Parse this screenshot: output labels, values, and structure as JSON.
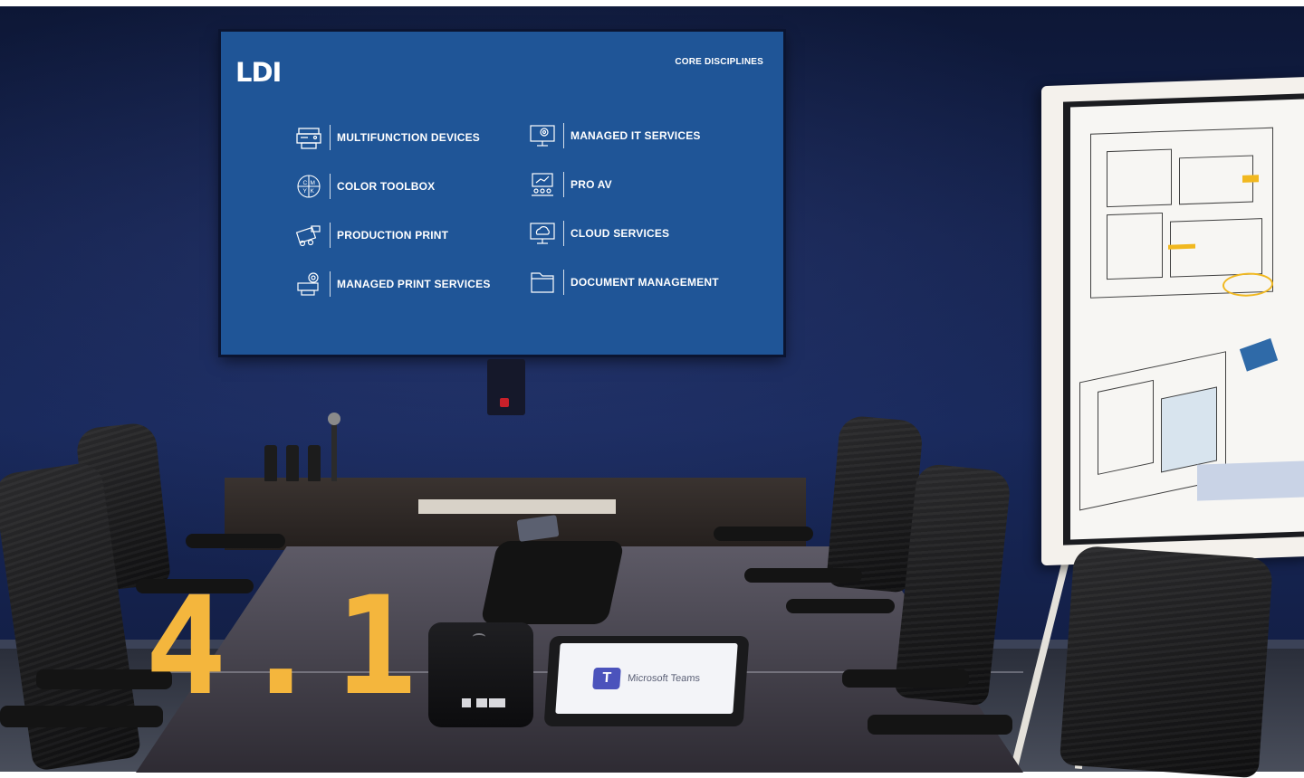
{
  "tv": {
    "logo": "LDI",
    "heading": "CORE DISCIPLINES",
    "disciplines": [
      {
        "label": "MULTIFUNCTION DEVICES",
        "icon": "printer-icon"
      },
      {
        "label": "COLOR TOOLBOX",
        "icon": "cmyk-icon"
      },
      {
        "label": "PRODUCTION PRINT",
        "icon": "production-printer-icon"
      },
      {
        "label": "MANAGED PRINT SERVICES",
        "icon": "print-gear-icon"
      },
      {
        "label": "MANAGED IT SERVICES",
        "icon": "monitor-gear-icon"
      },
      {
        "label": "PRO AV",
        "icon": "presentation-icon"
      },
      {
        "label": "CLOUD SERVICES",
        "icon": "cloud-monitor-icon"
      },
      {
        "label": "DOCUMENT MANAGEMENT",
        "icon": "folder-icon"
      }
    ],
    "cmyk_letters": [
      "C",
      "M",
      "Y",
      "K"
    ]
  },
  "tablet": {
    "app_name": "Microsoft Teams",
    "icon_letter": "T"
  },
  "overlay": {
    "left": "4",
    "dot": ".",
    "right": "1"
  },
  "colors": {
    "tv_background": "#1f5597",
    "overlay_number": "#f4b63d",
    "wall": "#15224d",
    "teams_purple": "#4b53bc"
  }
}
